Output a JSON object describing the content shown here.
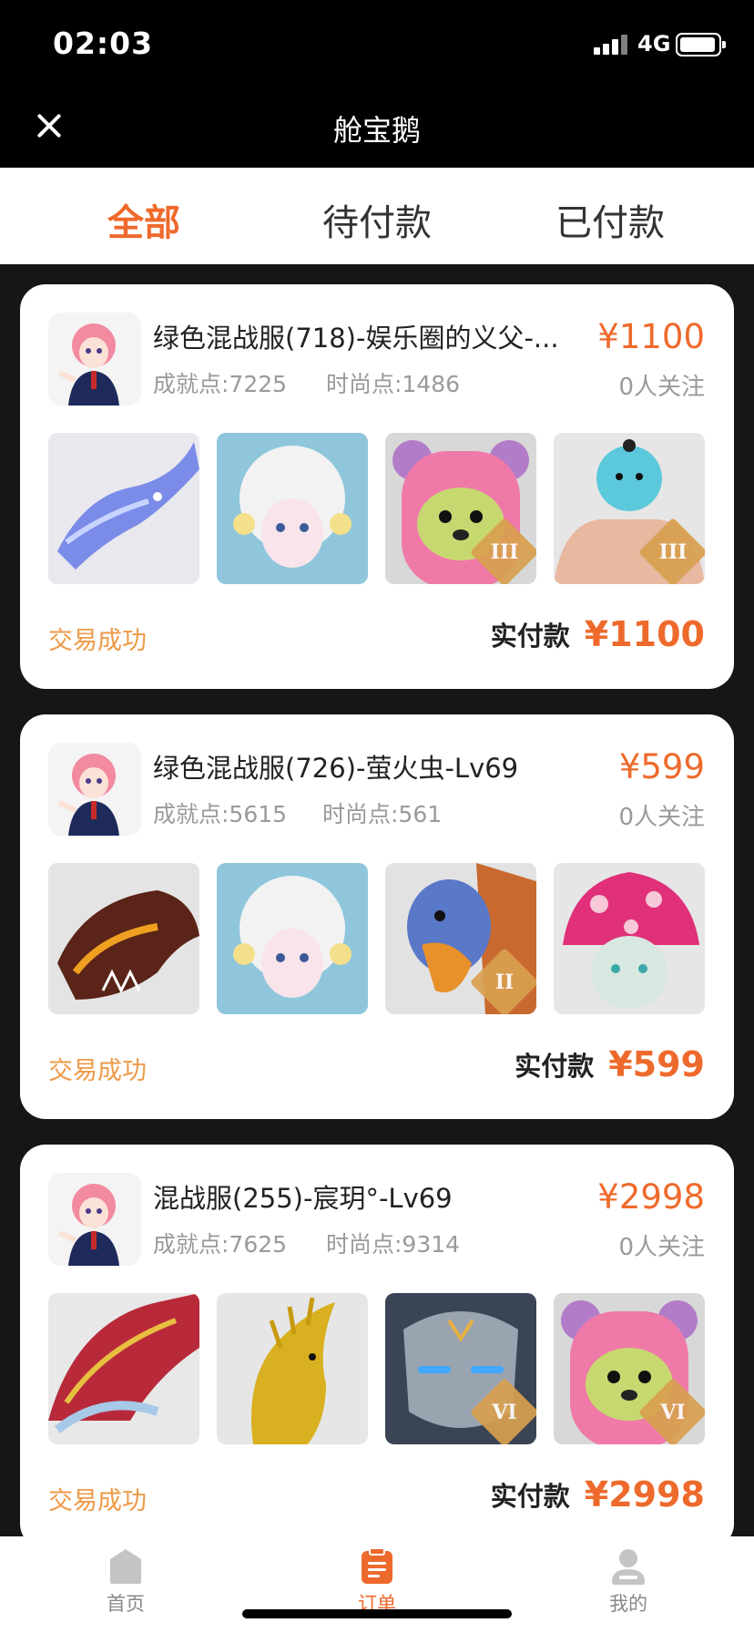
{
  "status_bar": {
    "time": "02:03",
    "network": "4G"
  },
  "nav": {
    "title": "舱宝鹅",
    "close_icon": "close-icon"
  },
  "tabs": [
    {
      "label": "全部",
      "active": true
    },
    {
      "label": "待付款",
      "active": false
    },
    {
      "label": "已付款",
      "active": false
    }
  ],
  "orders": [
    {
      "title": "绿色混战服(718)-娱乐圈的义父-...",
      "achievement": "成就点:7225",
      "fashion": "时尚点:1486",
      "price": "¥1100",
      "followers": "0人关注",
      "status": "交易成功",
      "paid_label": "实付款",
      "paid_value": "¥1100",
      "thumbs": [
        {
          "icon": "blue-dragon-icon",
          "badge": ""
        },
        {
          "icon": "white-hair-doll-icon",
          "badge": ""
        },
        {
          "icon": "pink-bear-icon",
          "badge": "III"
        },
        {
          "icon": "muscle-bird-icon",
          "badge": "III"
        }
      ]
    },
    {
      "title": "绿色混战服(726)-萤火虫-Lv69",
      "achievement": "成就点:5615",
      "fashion": "时尚点:561",
      "price": "¥599",
      "followers": "0人关注",
      "status": "交易成功",
      "paid_label": "实付款",
      "paid_value": "¥599",
      "thumbs": [
        {
          "icon": "fire-dragon-icon",
          "badge": ""
        },
        {
          "icon": "white-hair-doll-icon",
          "badge": ""
        },
        {
          "icon": "eagle-icon",
          "badge": "II"
        },
        {
          "icon": "mushroom-icon",
          "badge": ""
        }
      ]
    },
    {
      "title": "混战服(255)-宸玥°-Lv69",
      "achievement": "成就点:7625",
      "fashion": "时尚点:9314",
      "price": "¥2998",
      "followers": "0人关注",
      "status": "交易成功",
      "paid_label": "实付款",
      "paid_value": "¥2998",
      "thumbs": [
        {
          "icon": "red-dragon-icon",
          "badge": ""
        },
        {
          "icon": "gold-phoenix-icon",
          "badge": ""
        },
        {
          "icon": "stone-mask-icon",
          "badge": "VI"
        },
        {
          "icon": "pink-bear-icon",
          "badge": "VI"
        }
      ]
    }
  ],
  "bottom_tabs": [
    {
      "label": "首页",
      "icon": "home-icon",
      "active": false
    },
    {
      "label": "订单",
      "icon": "order-icon",
      "active": true
    },
    {
      "label": "我的",
      "icon": "profile-icon",
      "active": false
    }
  ],
  "colors": {
    "accent": "#ee6a2c",
    "status": "#ee9a48",
    "background": "#161616"
  }
}
